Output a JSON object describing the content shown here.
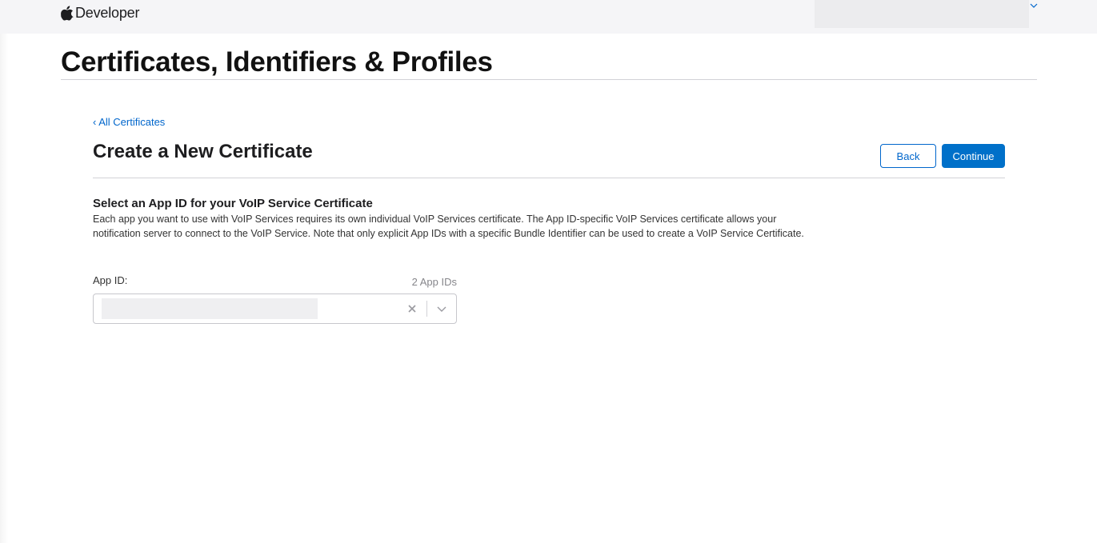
{
  "header": {
    "brand_name": "Developer",
    "logo_icon": "apple-logo-icon",
    "account_chevron_icon": "chevron-down-icon"
  },
  "section": {
    "title": "Certificates, Identifiers & Profiles"
  },
  "breadcrumb": {
    "back_link": "‹ All Certificates"
  },
  "page": {
    "title": "Create a New Certificate",
    "buttons": {
      "back": "Back",
      "continue": "Continue"
    }
  },
  "form": {
    "heading": "Select an App ID for your VoIP Service Certificate",
    "description": "Each app you want to use with VoIP Services requires its own individual VoIP Services certificate. The App ID-specific VoIP Services certificate allows your notification server to connect to the VoIP Service. Note that only explicit App IDs with a specific Bundle Identifier can be used to create a VoIP Service Certificate.",
    "app_id_label": "App ID:",
    "app_id_count": "2 App IDs",
    "clear_icon": "close-icon",
    "dropdown_icon": "chevron-down-icon"
  },
  "colors": {
    "accent": "#0070c9",
    "link": "#0066cc",
    "header_bg": "#f5f5f7"
  }
}
